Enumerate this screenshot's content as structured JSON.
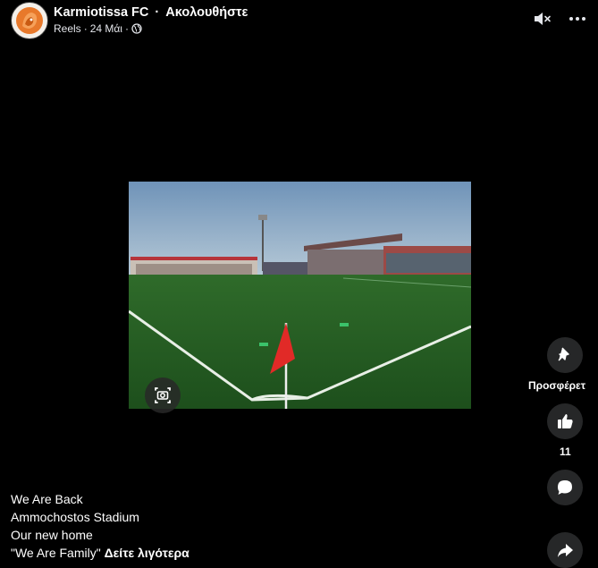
{
  "header": {
    "page_name": "Karmiotissa FC",
    "separator": "·",
    "follow_label": "Ακολουθήστε",
    "meta_type": "Reels",
    "meta_sep": "·",
    "meta_date": "24 Μάι",
    "meta_sep2": "·"
  },
  "actions": {
    "offer_label": "Προσφέρετ",
    "like_count": "11"
  },
  "caption": {
    "lines": [
      "We Are Back",
      "Ammochostos Stadium",
      "Our new home"
    ],
    "last_line": "\"We Are Family\"",
    "see_more": "Δείτε λιγότερα"
  },
  "colors": {
    "background": "#000000",
    "action_button": "#262728",
    "avatar_orange": "#e8792b"
  },
  "icons": {
    "mute": "speaker-muted-icon",
    "more": "more-options-icon",
    "privacy": "globe-icon",
    "lens": "visual-search-icon",
    "offer": "magic-pin-icon",
    "like": "thumbs-up-icon",
    "comment": "comment-bubble-icon",
    "share": "share-arrow-icon"
  }
}
